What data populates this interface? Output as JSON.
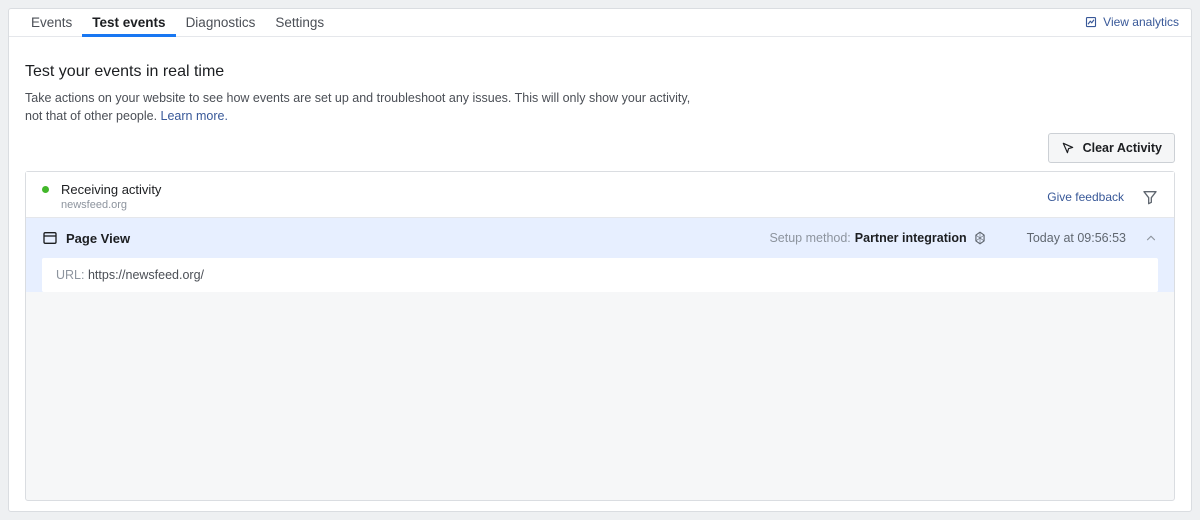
{
  "tabs": {
    "events": "Events",
    "test_events": "Test events",
    "diagnostics": "Diagnostics",
    "settings": "Settings"
  },
  "view_analytics": "View analytics",
  "section": {
    "title": "Test your events in real time",
    "subtitle": "Take actions on your website to see how events are set up and troubleshoot any issues. This will only show your activity, not that of other people.",
    "learn_more": "Learn more."
  },
  "clear_activity": "Clear Activity",
  "status": {
    "label": "Receiving activity",
    "domain": "newsfeed.org",
    "feedback": "Give feedback"
  },
  "event": {
    "name": "Page View",
    "setup_label": "Setup method:",
    "setup_value": "Partner integration",
    "time": "Today at 09:56:53",
    "url_label": "URL:",
    "url_value": "https://newsfeed.org/"
  }
}
